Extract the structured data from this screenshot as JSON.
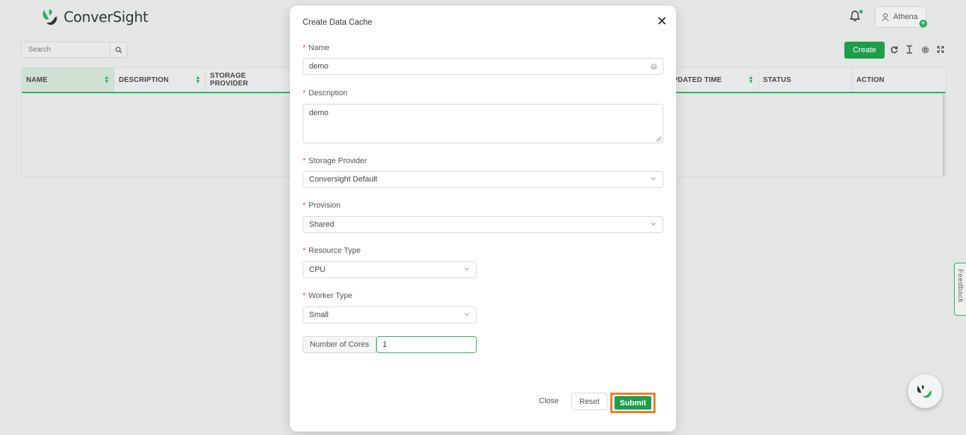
{
  "app": {
    "brand": "ConverSight",
    "user": "Athena"
  },
  "toolbar": {
    "search_placeholder": "Search",
    "create_label": "Create"
  },
  "table": {
    "columns": [
      "NAME",
      "DESCRIPTION",
      "STORAGE PROVIDER",
      "UPDATED TIME",
      "STATUS",
      "ACTION"
    ]
  },
  "feedback_label": "Feedback",
  "modal": {
    "title": "Create Data Cache",
    "name_label": "Name",
    "name_value": "demo",
    "description_label": "Description",
    "description_value": "demo",
    "storage_label": "Storage Provider",
    "storage_value": "Conversight Default",
    "provision_label": "Provision",
    "provision_value": "Shared",
    "resource_label": "Resource Type",
    "resource_value": "CPU",
    "worker_label": "Worker Type",
    "worker_value": "Small",
    "cores_label": "Number of Cores",
    "cores_value": "1",
    "close_label": "Close",
    "reset_label": "Reset",
    "submit_label": "Submit"
  },
  "colors": {
    "accent": "#1e9d4a",
    "highlight": "#f07c1e",
    "required": "#e0453a"
  }
}
